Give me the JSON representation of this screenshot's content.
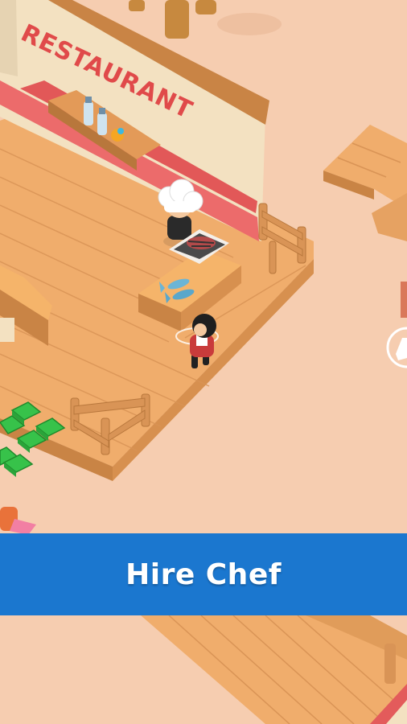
{
  "scene": {
    "sign_text": "RESTAURANT",
    "colors": {
      "ground": "#f6cdb0",
      "wood_floor": "#f0ad6c",
      "wood_dark": "#c98445",
      "wall": "#f3e1c1",
      "wall_trim": "#ec6b6b",
      "sign_text": "#e04a4a",
      "banner": "#1b77cf"
    },
    "icons": [
      "chef-hat-icon",
      "grill-icon",
      "fish-icon",
      "cash-stack-icon",
      "hand-icon"
    ]
  },
  "banner": {
    "label": "Hire Chef"
  }
}
